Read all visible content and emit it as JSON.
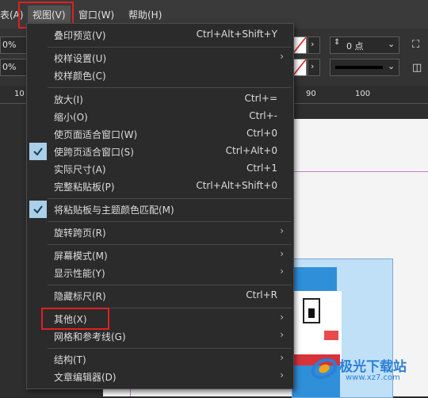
{
  "menubar": {
    "items": [
      "表(A)",
      "视图(V)",
      "窗口(W)",
      "帮助(H)"
    ]
  },
  "toolbar": {
    "left_field_1": "0%",
    "left_field_2": "0%",
    "stroke_weight": "0 点"
  },
  "ruler": {
    "ticks": [
      "10",
      "90",
      "100"
    ]
  },
  "view_menu": {
    "items": [
      {
        "label": "叠印预览(V)",
        "shortcut": "Ctrl+Alt+Shift+Y"
      },
      {
        "label": "校样设置(U)",
        "submenu": true
      },
      {
        "label": "校样颜色(C)"
      },
      {
        "label": "放大(I)",
        "shortcut": "Ctrl+="
      },
      {
        "label": "缩小(O)",
        "shortcut": "Ctrl+-"
      },
      {
        "label": "使页面适合窗口(W)",
        "shortcut": "Ctrl+0"
      },
      {
        "label": "使跨页适合窗口(S)",
        "shortcut": "Ctrl+Alt+0",
        "checked": true
      },
      {
        "label": "实际尺寸(A)",
        "shortcut": "Ctrl+1"
      },
      {
        "label": "完整粘贴板(P)",
        "shortcut": "Ctrl+Alt+Shift+0"
      },
      {
        "label": "将粘贴板与主题颜色匹配(M)",
        "checked": true
      },
      {
        "label": "旋转跨页(R)",
        "submenu": true
      },
      {
        "label": "屏幕模式(M)",
        "submenu": true
      },
      {
        "label": "显示性能(Y)",
        "submenu": true
      },
      {
        "label": "隐藏标尺(R)",
        "shortcut": "Ctrl+R"
      },
      {
        "label": "其他(X)",
        "submenu": true
      },
      {
        "label": "网格和参考线(G)",
        "submenu": true
      },
      {
        "label": "结构(T)",
        "submenu": true
      },
      {
        "label": "文章编辑器(D)",
        "submenu": true
      }
    ]
  },
  "watermark": {
    "text": "极光下载站",
    "url": "www.xz7.com"
  },
  "colors": {
    "highlight": "#e02020",
    "check_bg": "#a9cfe9"
  }
}
